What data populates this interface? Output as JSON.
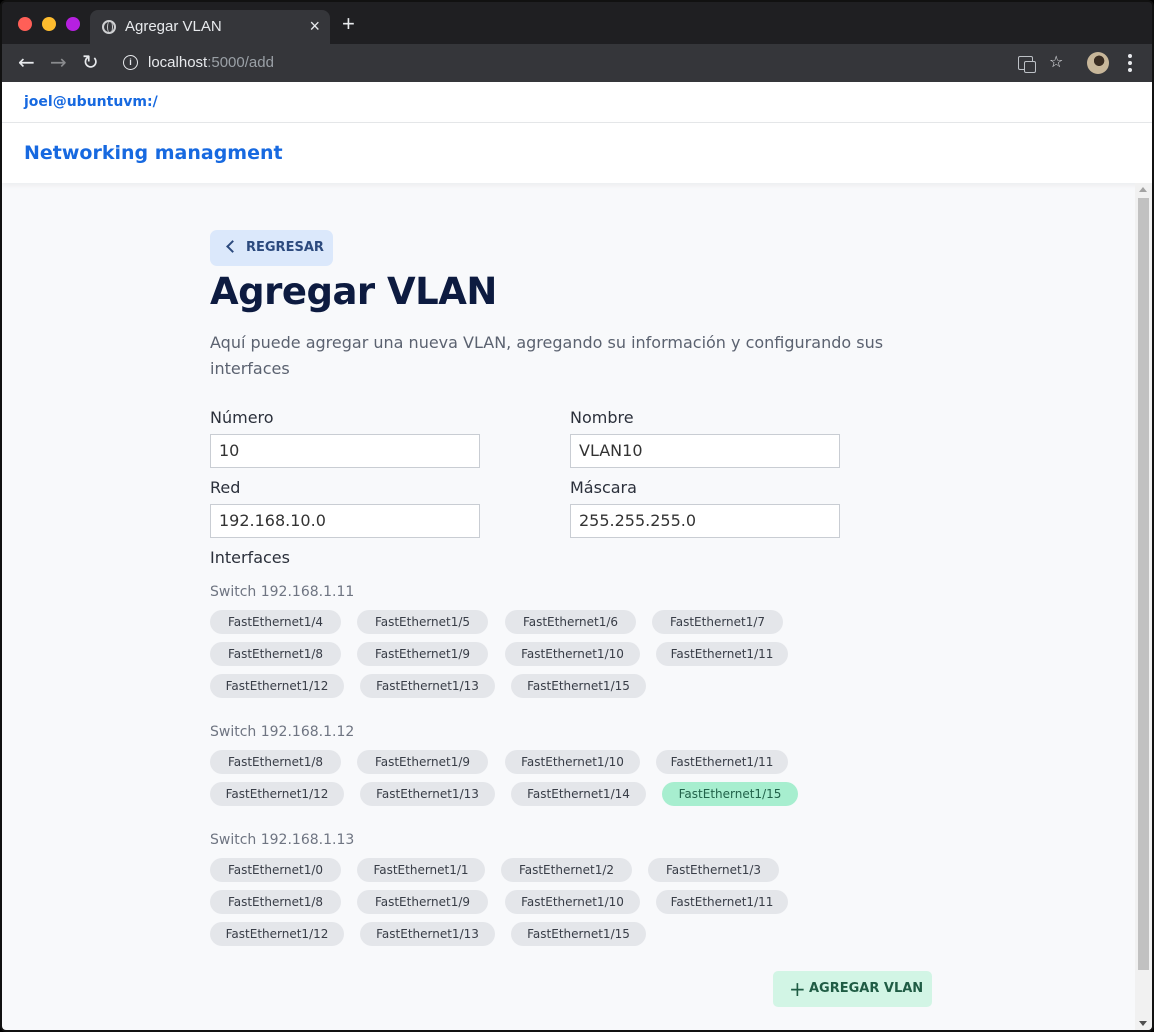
{
  "browser": {
    "tab_title": "Agregar VLAN",
    "tab_close": "×",
    "new_tab": "+",
    "url_host": "localhost",
    "url_path": ":5000/add"
  },
  "topbar": {
    "user": "joel@ubuntuvm:/"
  },
  "header": {
    "brand": "Networking managment"
  },
  "page": {
    "back_label": "REGRESAR",
    "title": "Agregar VLAN",
    "description": "Aquí puede agregar una nueva VLAN, agregando su información y configurando sus interfaces"
  },
  "form": {
    "numero": {
      "label": "Número",
      "value": "10"
    },
    "nombre": {
      "label": "Nombre",
      "value": "VLAN10"
    },
    "red": {
      "label": "Red",
      "value": "192.168.10.0"
    },
    "mascara": {
      "label": "Máscara",
      "value": "255.255.255.0"
    },
    "interfaces_label": "Interfaces"
  },
  "switches": [
    {
      "name": "Switch 192.168.1.11",
      "interfaces": [
        {
          "name": "FastEthernet1/4",
          "selected": false
        },
        {
          "name": "FastEthernet1/5",
          "selected": false
        },
        {
          "name": "FastEthernet1/6",
          "selected": false
        },
        {
          "name": "FastEthernet1/7",
          "selected": false
        },
        {
          "name": "FastEthernet1/8",
          "selected": false
        },
        {
          "name": "FastEthernet1/9",
          "selected": false
        },
        {
          "name": "FastEthernet1/10",
          "selected": false
        },
        {
          "name": "FastEthernet1/11",
          "selected": false
        },
        {
          "name": "FastEthernet1/12",
          "selected": false
        },
        {
          "name": "FastEthernet1/13",
          "selected": false
        },
        {
          "name": "FastEthernet1/15",
          "selected": false
        }
      ]
    },
    {
      "name": "Switch 192.168.1.12",
      "interfaces": [
        {
          "name": "FastEthernet1/8",
          "selected": false
        },
        {
          "name": "FastEthernet1/9",
          "selected": false
        },
        {
          "name": "FastEthernet1/10",
          "selected": false
        },
        {
          "name": "FastEthernet1/11",
          "selected": false
        },
        {
          "name": "FastEthernet1/12",
          "selected": false
        },
        {
          "name": "FastEthernet1/13",
          "selected": false
        },
        {
          "name": "FastEthernet1/14",
          "selected": false
        },
        {
          "name": "FastEthernet1/15",
          "selected": true
        }
      ]
    },
    {
      "name": "Switch 192.168.1.13",
      "interfaces": [
        {
          "name": "FastEthernet1/0",
          "selected": false
        },
        {
          "name": "FastEthernet1/1",
          "selected": false
        },
        {
          "name": "FastEthernet1/2",
          "selected": false
        },
        {
          "name": "FastEthernet1/3",
          "selected": false
        },
        {
          "name": "FastEthernet1/8",
          "selected": false
        },
        {
          "name": "FastEthernet1/9",
          "selected": false
        },
        {
          "name": "FastEthernet1/10",
          "selected": false
        },
        {
          "name": "FastEthernet1/11",
          "selected": false
        },
        {
          "name": "FastEthernet1/12",
          "selected": false
        },
        {
          "name": "FastEthernet1/13",
          "selected": false
        },
        {
          "name": "FastEthernet1/15",
          "selected": false
        }
      ]
    }
  ],
  "actions": {
    "add_label": "AGREGAR VLAN",
    "add_icon": "plus-icon"
  },
  "colors": {
    "brand": "#1769e0",
    "title": "#0d1b40",
    "chip": "#e4e6ea",
    "chip_selected": "#a7eecf",
    "add_button": "#d2f5e5",
    "back_button": "#dbe8fb"
  }
}
